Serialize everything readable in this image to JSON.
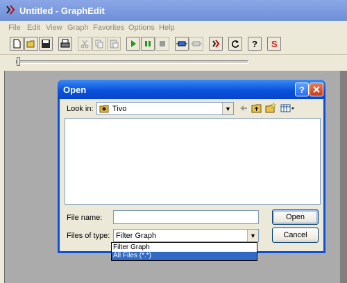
{
  "app": {
    "title": "Untitled - GraphEdit",
    "menu": [
      "File",
      "Edit",
      "View",
      "Graph",
      "Favorites",
      "Options",
      "Help"
    ],
    "toolbar_icons": [
      "new-icon",
      "open-icon",
      "save-icon",
      "print-icon",
      "cut-icon",
      "copy-icon",
      "paste-icon",
      "play-icon",
      "pause-icon",
      "stop-icon",
      "connect-icon",
      "filter-icon",
      "graphedit-icon",
      "refresh-icon",
      "help-icon",
      "s-icon"
    ],
    "seek_position": 0
  },
  "dialog": {
    "title": "Open",
    "help_label": "?",
    "lookin_label": "Look in:",
    "lookin_value": "Tivo",
    "filename_label": "File name:",
    "filename_value": "",
    "filetype_label": "Files of type:",
    "filetype_value": "Filter Graph",
    "open_label": "Open",
    "cancel_label": "Cancel",
    "filetype_options": [
      "Filter Graph",
      "All Files (*.*)"
    ],
    "selected_option": 1
  },
  "colors": {
    "titlebar": "#0a52dc",
    "selection": "#316ac5"
  }
}
